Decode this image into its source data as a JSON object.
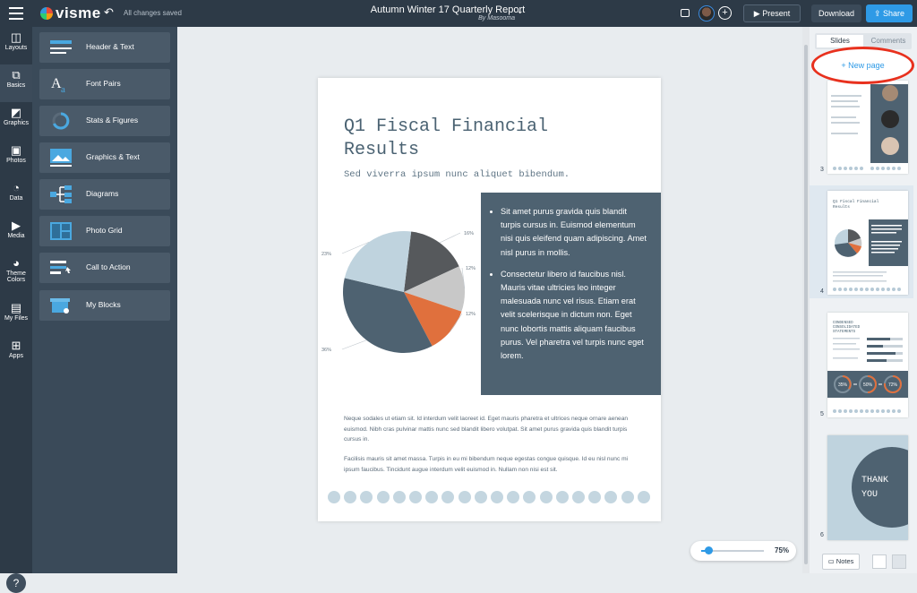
{
  "header": {
    "logo": "visme",
    "save_status": "All changes saved",
    "doc_title": "Autumn Winter 17 Quarterly Report",
    "doc_author": "By Masooma",
    "present_label": "Present",
    "download_label": "Download",
    "share_label": "Share"
  },
  "rail": {
    "items": [
      {
        "label": "Layouts",
        "icon": "layouts-icon"
      },
      {
        "label": "Basics",
        "icon": "basics-icon"
      },
      {
        "label": "Graphics",
        "icon": "graphics-icon"
      },
      {
        "label": "Photos",
        "icon": "photos-icon"
      },
      {
        "label": "Data",
        "icon": "data-icon"
      },
      {
        "label": "Media",
        "icon": "media-icon"
      },
      {
        "label": "Theme Colors",
        "icon": "palette-icon"
      },
      {
        "label": "My Files",
        "icon": "folder-icon"
      },
      {
        "label": "Apps",
        "icon": "apps-icon"
      }
    ],
    "help": "?"
  },
  "panel": {
    "items": [
      {
        "label": "Header & Text"
      },
      {
        "label": "Font Pairs"
      },
      {
        "label": "Stats & Figures"
      },
      {
        "label": "Graphics & Text"
      },
      {
        "label": "Diagrams"
      },
      {
        "label": "Photo Grid"
      },
      {
        "label": "Call to Action"
      },
      {
        "label": "My Blocks"
      }
    ]
  },
  "page": {
    "title": "Q1 Fiscal Financial Results",
    "subtitle": "Sed viverra ipsum nunc aliquet bibendum.",
    "bullets": [
      "Sit amet purus gravida quis blandit turpis cursus in. Euismod elementum nisi quis eleifend quam adipiscing. Amet nisl purus in mollis.",
      "Consectetur libero id faucibus nisl. Mauris vitae ultricies leo integer malesuada nunc vel risus. Etiam erat velit scelerisque in dictum non. Eget nunc lobortis mattis aliquam faucibus purus. Vel pharetra vel turpis nunc eget lorem."
    ],
    "para1": "Neque sodales ut etiam sit. Id interdum velit laoreet id. Eget mauris pharetra et ultrices neque ornare aenean euismod. Nibh cras pulvinar mattis nunc sed blandit libero volutpat. Sit amet purus gravida quis blandit turpis cursus in.",
    "para2": "Facilisis mauris sit amet massa. Turpis in eu mi bibendum neque egestas congue quisque. Id eu nisl nunc mi ipsum faucibus. Tincidunt augue interdum velit euismod in. Nullam non nisi est sit."
  },
  "chart_data": {
    "type": "pie",
    "values": [
      16,
      12,
      12,
      36,
      23
    ],
    "labels": [
      "16%",
      "12%",
      "12%",
      "36%",
      "23%"
    ],
    "colors": [
      "#56595c",
      "#c8c8c8",
      "#e0703d",
      "#4e6271",
      "#bfd3de"
    ]
  },
  "zoom": {
    "label": "75%",
    "value": 0.75
  },
  "right_panel": {
    "tab_slides": "Slides",
    "tab_comments": "Comments",
    "new_page": "+ New page",
    "thumbs": [
      {
        "num": "3"
      },
      {
        "num": "4",
        "title": "Q1 Fiscal Financial Results"
      },
      {
        "num": "5",
        "title": "CONDENSED CONSOLIDATED STATEMENTS",
        "stats": [
          "35%",
          "50%",
          "72%"
        ]
      },
      {
        "num": "6",
        "text": "THANK YOU"
      }
    ],
    "notes_label": "Notes"
  }
}
